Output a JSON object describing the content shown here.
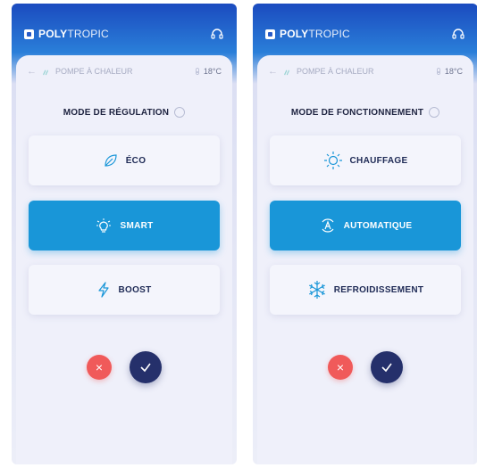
{
  "screens": [
    {
      "brand_bold": "POLY",
      "brand_light": "TROPIC",
      "nav_title": "POMPE À CHALEUR",
      "temperature": "18°C",
      "mode_title": "MODE DE RÉGULATION",
      "options": [
        {
          "label": "ÉCO",
          "icon": "leaf-icon",
          "selected": false
        },
        {
          "label": "SMART",
          "icon": "lightbulb-icon",
          "selected": true
        },
        {
          "label": "BOOST",
          "icon": "lightning-icon",
          "selected": false
        }
      ],
      "cancel_symbol": "×"
    },
    {
      "brand_bold": "POLY",
      "brand_light": "TROPIC",
      "nav_title": "POMPE À CHALEUR",
      "temperature": "18°C",
      "mode_title": "MODE DE FONCTIONNEMENT",
      "options": [
        {
          "label": "CHAUFFAGE",
          "icon": "sun-icon",
          "selected": false
        },
        {
          "label": "AUTOMATIQUE",
          "icon": "auto-icon",
          "selected": true
        },
        {
          "label": "REFROIDISSEMENT",
          "icon": "snowflake-icon",
          "selected": false
        }
      ],
      "cancel_symbol": "×"
    }
  ],
  "colors": {
    "header_top": "#1b4bbf",
    "selected_option": "#1996d8",
    "cancel": "#f05a5a",
    "confirm": "#25306b",
    "icon_blue": "#1996d8"
  }
}
